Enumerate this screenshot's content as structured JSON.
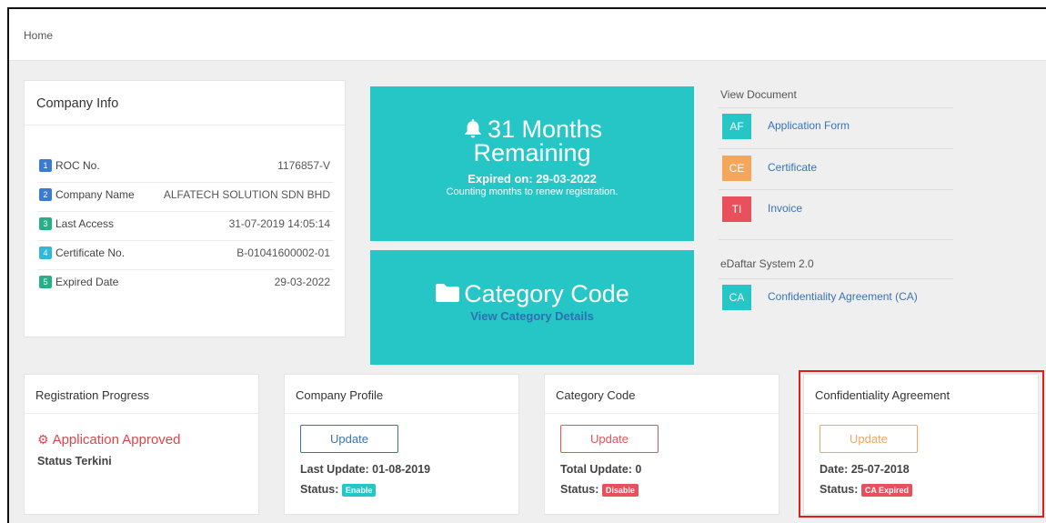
{
  "breadcrumb": "Home",
  "company_info": {
    "title": "Company Info",
    "rows": [
      {
        "num": "1",
        "label": "ROC No.",
        "value": "1176857-V",
        "color": "#3a7bd5"
      },
      {
        "num": "2",
        "label": "Company Name",
        "value": "ALFATECH SOLUTION SDN BHD",
        "color": "#3a7bd5"
      },
      {
        "num": "3",
        "label": "Last Access",
        "value": "31-07-2019 14:05:14",
        "color": "#26b08a"
      },
      {
        "num": "4",
        "label": "Certificate No.",
        "value": "B-01041600002-01",
        "color": "#2fb8d8"
      },
      {
        "num": "5",
        "label": "Expired Date",
        "value": "29-03-2022",
        "color": "#26b08a"
      }
    ]
  },
  "months_tile": {
    "line1": "31 Months",
    "line2": "Remaining",
    "expired": "Expired on: 29-03-2022",
    "counting": "Counting months to renew registration."
  },
  "category_tile": {
    "title": "Category Code",
    "link": "View Category Details"
  },
  "documents": {
    "view_document_heading": "View Document",
    "items": [
      {
        "code": "AF",
        "label": "Application Form",
        "color": "#26c6c6"
      },
      {
        "code": "CE",
        "label": "Certificate",
        "color": "#f5a65b"
      },
      {
        "code": "TI",
        "label": "Invoice",
        "color": "#e8505b"
      }
    ],
    "edaftar_heading": "eDaftar System 2.0",
    "edaftar_items": [
      {
        "code": "CA",
        "label": "Confidentiality Agreement (CA)",
        "color": "#26c6c6"
      }
    ]
  },
  "registration_progress": {
    "title": "Registration Progress",
    "status": "Application Approved",
    "subtitle": "Status Terkini"
  },
  "company_profile": {
    "title": "Company Profile",
    "button": "Update",
    "last_update": "Last Update: 01-08-2019",
    "status_label": "Status:",
    "status_tag": "Enable",
    "button_color": "#3a72b5",
    "tag_color": "#26c6c6"
  },
  "category_code": {
    "title": "Category Code",
    "button": "Update",
    "total_update": "Total Update: 0",
    "status_label": "Status:",
    "status_tag": "Disable",
    "button_color": "#e8505b",
    "tag_color": "#e8505b"
  },
  "confidentiality_agreement": {
    "title": "Confidentiality Agreement",
    "button": "Update",
    "date": "Date: 25-07-2018",
    "status_label": "Status:",
    "status_tag": "CA Expired",
    "button_color": "#f5a65b",
    "tag_color": "#e8505b"
  }
}
